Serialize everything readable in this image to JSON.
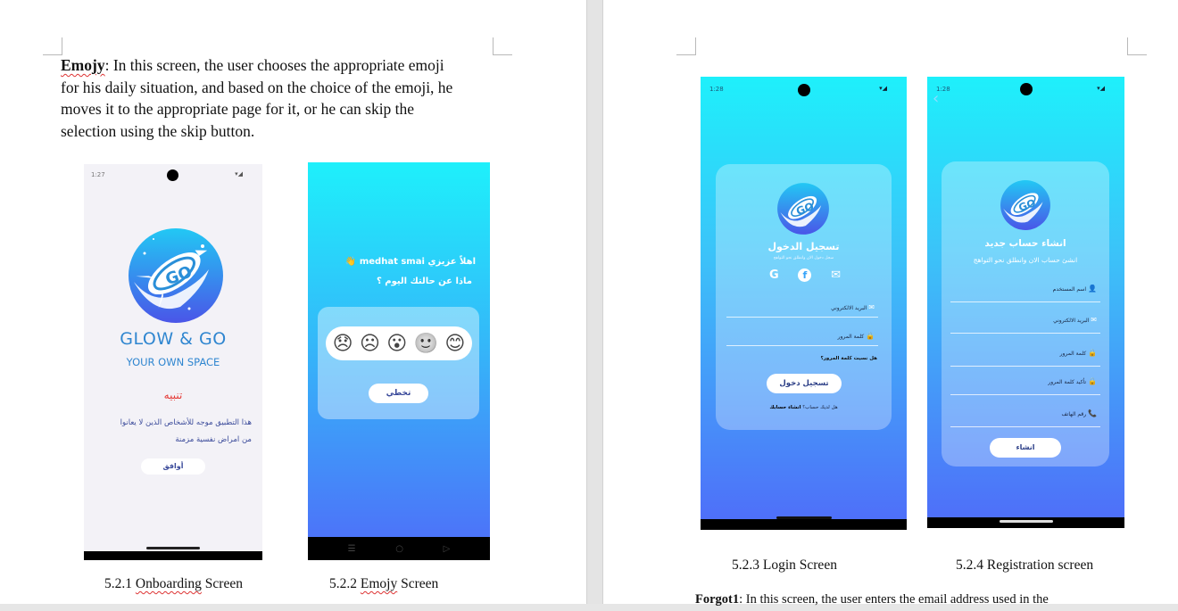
{
  "left_page": {
    "intro": {
      "term": "Emojy",
      "body_l1": ": In this screen, the user chooses the appropriate emoji",
      "body_l2": "for his daily situation, and based on the choice of the emoji, he",
      "body_l3": "moves it to the appropriate page for it, or he can skip the",
      "body_l4": "selection using the skip button."
    },
    "onboarding": {
      "time": "1:27",
      "status_icons": "▾◢",
      "logo_text": "GO",
      "brand": "GLOW & GO",
      "tagline": "YOUR OWN SPACE",
      "warning_title": "تنبيه",
      "warning_line1": "هذا التطبيق موجه للأشخاص الذين لا يعانوا",
      "warning_line2": "من امراض نفسية مزمنة",
      "agree": "أوافق",
      "caption_num": "5.2.1",
      "caption_word": "Onboarding",
      "caption_rest": "Screen"
    },
    "emojy": {
      "greeting": "اهلاً عزيزي medhat smai 👋",
      "question": "ماذا عن حالتك اليوم ؟",
      "faces": [
        "😊",
        "🙂",
        "😮",
        "☹",
        "😞"
      ],
      "skip": "تخطي",
      "nav": [
        "☰",
        "○",
        "▷"
      ],
      "caption_num": "5.2.2",
      "caption_word": "Emojy",
      "caption_rest": "Screen"
    }
  },
  "right_page": {
    "login": {
      "time": "1:28",
      "status_icons": "▾◢",
      "logo_text": "GO",
      "title": "تسجيل الدخول",
      "subtitle": "سجل دخول الان وانطلق نحو التواهج",
      "social": [
        "G",
        "f",
        "✉"
      ],
      "email_label": "البريد الالكتروني",
      "password_label": "كلمة المرور",
      "forgot": "هل نسيت كلمة المرور؟",
      "login_btn": "تسجيل دخول",
      "no_account": "هل لديك حساب؟",
      "create": "انشاء حسابك",
      "caption": "5.2.3 Login Screen"
    },
    "registration": {
      "time": "1:28",
      "status_icons": "▾◢",
      "back": "‹",
      "logo_text": "GO",
      "title": "انشاء حساب جديد",
      "subtitle": "انشئ حساب الان وانطلق نحو التواهج",
      "fields": [
        "اسم المستخدم",
        "البريد الالكتروني",
        "كلمة المرور",
        "تأكيد كلمة المرور",
        "رقم الهاتف"
      ],
      "field_icons": [
        "👤",
        "✉",
        "🔒",
        "🔒",
        "📞"
      ],
      "create_btn": "انشاء",
      "caption": "5.2.4 Registration screen"
    },
    "forgot_para": {
      "term": "Forgot1",
      "body": ": In this screen, the user enters the email address used in the"
    }
  },
  "colors": {
    "gradient_top": "#1ef0fb",
    "gradient_bottom": "#4f6cf9",
    "brand_blue": "#2f86d0",
    "warning_red": "#e53935",
    "onboarding_bg": "#f3f2f7"
  }
}
